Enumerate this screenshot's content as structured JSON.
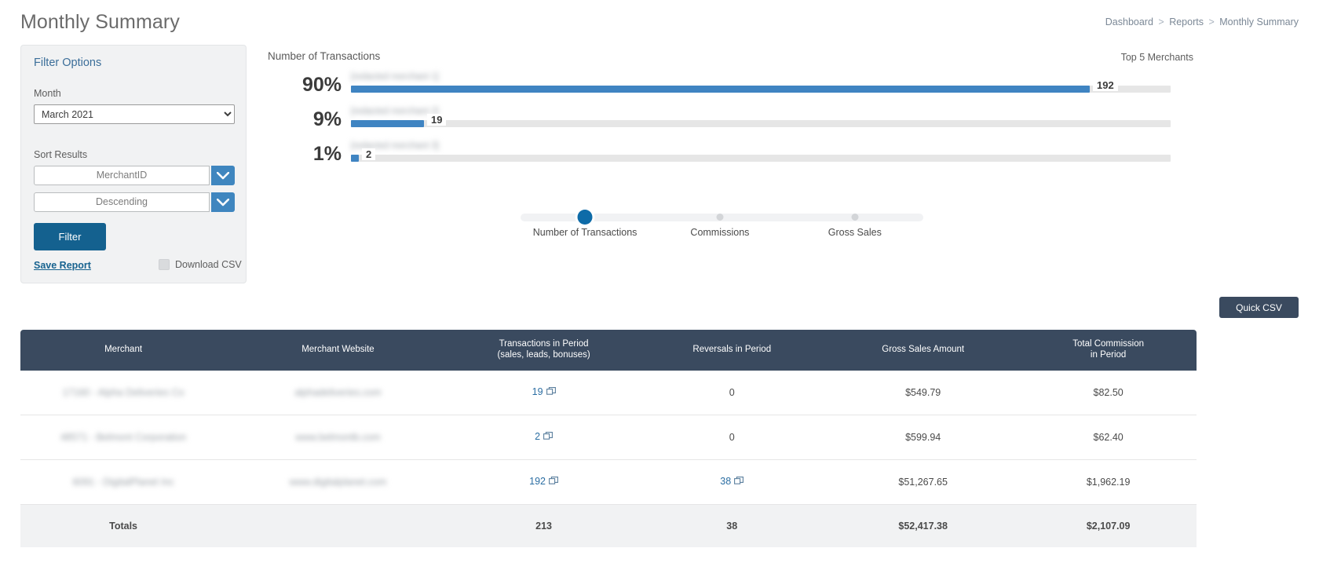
{
  "page": {
    "title": "Monthly Summary"
  },
  "breadcrumb": {
    "items": [
      "Dashboard",
      "Reports",
      "Monthly Summary"
    ],
    "separator": ">"
  },
  "filter_panel": {
    "title": "Filter Options",
    "month_label": "Month",
    "month_value": "March 2021",
    "month_options": [
      "March 2021"
    ],
    "sort_label": "Sort Results",
    "sort_field_value": "MerchantID",
    "sort_direction_value": "Descending",
    "filter_button": "Filter",
    "save_report_link": "Save Report",
    "download_csv_label": "Download CSV"
  },
  "chart_panel": {
    "title": "Number of Transactions",
    "subtitle": "Top 5 Merchants",
    "quick_csv_button": "Quick CSV"
  },
  "metric_slider": {
    "steps": [
      {
        "label": "Number of Transactions",
        "active": true
      },
      {
        "label": "Commissions",
        "active": false
      },
      {
        "label": "Gross Sales",
        "active": false
      }
    ]
  },
  "chart_data": {
    "type": "bar",
    "title": "Number of Transactions",
    "subtitle": "Top 5 Merchants",
    "orientation": "horizontal",
    "xlabel": "",
    "ylabel": "",
    "grid": false,
    "legend": "none",
    "categories": [
      "[redacted merchant 1]",
      "[redacted merchant 2]",
      "[redacted merchant 3]"
    ],
    "values": [
      192,
      19,
      2
    ],
    "percent_labels": [
      "90%",
      "9%",
      "1%"
    ],
    "value_labels": [
      "192",
      "19",
      "2"
    ],
    "max_value": 213,
    "bar_color": "#3f84c2",
    "track_color": "#e6e6e6"
  },
  "table": {
    "columns": [
      {
        "label_line1": "Merchant",
        "label_line2": ""
      },
      {
        "label_line1": "Merchant Website",
        "label_line2": ""
      },
      {
        "label_line1": "Transactions in Period",
        "label_line2": "(sales, leads, bonuses)"
      },
      {
        "label_line1": "Reversals in Period",
        "label_line2": ""
      },
      {
        "label_line1": "Gross Sales Amount",
        "label_line2": ""
      },
      {
        "label_line1": "Total Commission",
        "label_line2": "in Period"
      }
    ],
    "rows": [
      {
        "merchant": "17160 - Alpha Deliveries Co",
        "website": "alphadeliveries.com",
        "transactions": "19",
        "transactions_is_link": true,
        "reversals": "0",
        "reversals_is_link": false,
        "gross_sales": "$549.79",
        "commission": "$82.50"
      },
      {
        "merchant": "48571 - Belmont Corporation",
        "website": "www.belmontb.com",
        "transactions": "2",
        "transactions_is_link": true,
        "reversals": "0",
        "reversals_is_link": false,
        "gross_sales": "$599.94",
        "commission": "$62.40"
      },
      {
        "merchant": "6091 - DigitalPlanet Inc",
        "website": "www.digitalplanet.com",
        "transactions": "192",
        "transactions_is_link": true,
        "reversals": "38",
        "reversals_is_link": true,
        "gross_sales": "$51,267.65",
        "commission": "$1,962.19"
      }
    ],
    "totals": {
      "label": "Totals",
      "transactions": "213",
      "reversals": "38",
      "gross_sales": "$52,417.38",
      "commission": "$2,107.09"
    }
  },
  "colors": {
    "accent_blue": "#3f84c2",
    "button_blue": "#14618f",
    "table_header": "#3a4a5f",
    "panel_bg": "#f1f2f3",
    "link": "#2b6ea3"
  }
}
